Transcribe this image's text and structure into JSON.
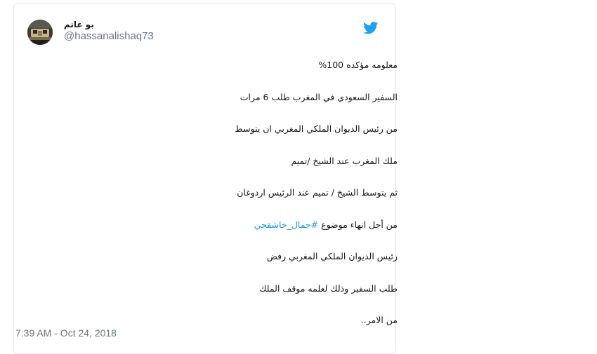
{
  "tweet": {
    "display_name": "بو غانم",
    "username": "@hassanalishaq73",
    "lines": [
      "معلومه مؤكده 100%",
      "السفير السعودي في المغرب طلب 6 مرات",
      "من رئيس الديوان الملكي المغربي ان يتوسط",
      "ملك المغرب عند الشيخ /تميم",
      "ثم يتوسط الشيخ / تميم عند الرئيس اردوغان",
      "من أجل انهاء موضوع ",
      "رئيس الديوان الملكي المغربي رفض",
      "طلب السفير وذلك لعلمه موقف الملك",
      "من الامر.."
    ],
    "hashtag": "#جمال_خاشقجي",
    "timestamp": "7:39 AM - Oct 24, 2018"
  },
  "colors": {
    "brand": "#1da1f2",
    "hashtag": "#1b95e0",
    "text": "#14171a",
    "muted": "#657786"
  },
  "icons": {
    "brand": "twitter-bird-icon",
    "avatar": "avatar-image"
  }
}
